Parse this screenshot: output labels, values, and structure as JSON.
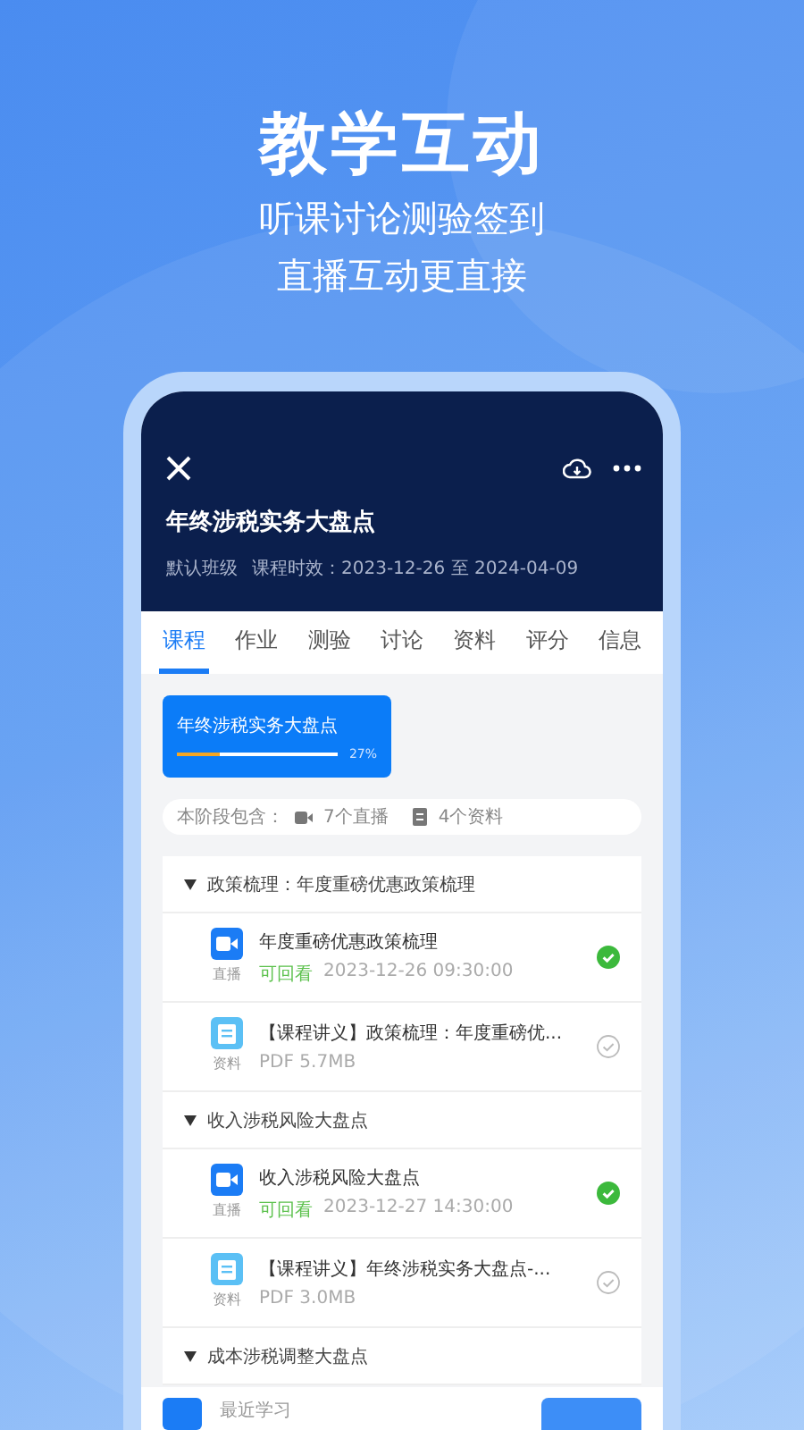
{
  "hero": {
    "title": "教学互动",
    "subtitle_lines": [
      "听课讨论测验签到",
      "直播互动更直接"
    ]
  },
  "course": {
    "title": "年终涉税实务大盘点",
    "class_name": "默认班级",
    "validity": "课程时效：2023-12-26 至 2024-04-09"
  },
  "tabs": [
    {
      "label": "课程",
      "selected": true
    },
    {
      "label": "作业",
      "selected": false
    },
    {
      "label": "测验",
      "selected": false
    },
    {
      "label": "讨论",
      "selected": false
    },
    {
      "label": "资料",
      "selected": false
    },
    {
      "label": "评分",
      "selected": false
    },
    {
      "label": "信息",
      "selected": false
    }
  ],
  "stage_card": {
    "title": "年终涉税实务大盘点",
    "level": 0.27,
    "percent": "27%"
  },
  "stage_info": {
    "label": "本阶段包含：",
    "live_count": "7个直播",
    "doc_count": "4个资料"
  },
  "sections": [
    {
      "title": "政策梳理：年度重磅优惠政策梳理",
      "expanded": true,
      "items": [
        {
          "kind": "live",
          "type_label": "直播",
          "title": "年度重磅优惠政策梳理",
          "status": "可回看",
          "meta": "2023-12-26 09:30:00",
          "completed": true
        },
        {
          "kind": "doc",
          "type_label": "资料",
          "title": "【课程讲义】政策梳理：年度重磅优...",
          "meta": "PDF 5.7MB",
          "completed": false
        }
      ]
    },
    {
      "title": "收入涉税风险大盘点",
      "expanded": true,
      "items": [
        {
          "kind": "live",
          "type_label": "直播",
          "title": "收入涉税风险大盘点",
          "status": "可回看",
          "meta": "2023-12-27 14:30:00",
          "completed": true
        },
        {
          "kind": "doc",
          "type_label": "资料",
          "title": "【课程讲义】年终涉税实务大盘点-...",
          "meta": "PDF 3.0MB",
          "completed": false
        }
      ]
    },
    {
      "title": "成本涉税调整大盘点",
      "expanded": true
    }
  ],
  "bottom_bar": {
    "label": "最近学习"
  }
}
